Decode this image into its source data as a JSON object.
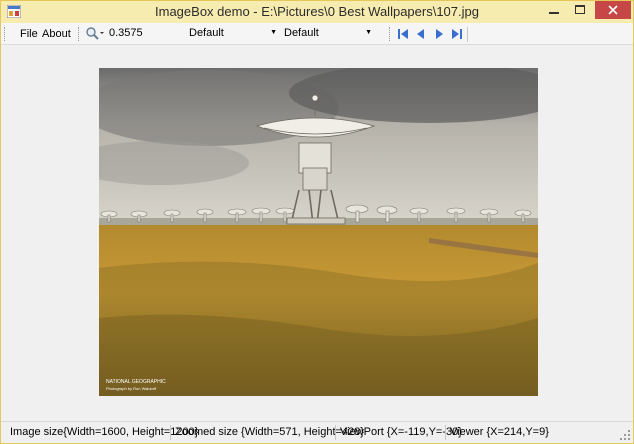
{
  "window": {
    "title": "ImageBox demo - E:\\Pictures\\0 Best Wallpapers\\107.jpg"
  },
  "menu": {
    "file": "File",
    "about": "About"
  },
  "toolbar": {
    "zoom_value": "0.3575",
    "combo1_value": "Default",
    "combo2_value": "Default"
  },
  "image": {
    "watermark_brand": "NATIONAL GEOGRAPHIC",
    "watermark_credit": "Photograph by Ron Waldorff"
  },
  "status": {
    "image_size": "Image size{Width=1600, Height=1200}",
    "zoomed_size": "Zoomed size {Width=571, Height=428}",
    "viewport": "ViewPort {X=-119,Y=-30}",
    "viewer": "Viewer {X=214,Y=9}"
  },
  "colors": {
    "titlebar": "#f7ecb0",
    "close_button": "#c74646",
    "nav_icons": "#3a6fd0"
  }
}
